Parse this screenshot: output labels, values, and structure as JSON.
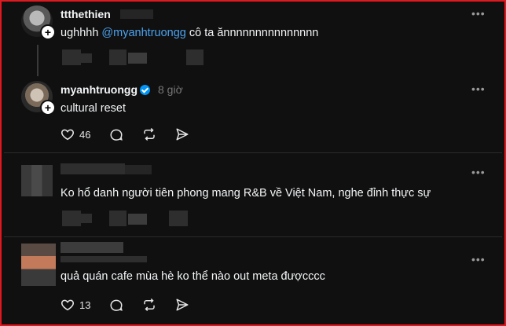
{
  "posts": [
    {
      "username": "ttthethien",
      "text_prefix": "ughhhh ",
      "mention": "@myanhtruongg",
      "text_suffix": " cô ta ănnnnnnnnnnnnnnn",
      "more": "•••"
    },
    {
      "username": "myanhtruongg",
      "time": "8 giờ",
      "text": "cultural reset",
      "likes": "46",
      "more": "•••"
    },
    {
      "text": "Ko hổ danh người tiên phong mang R&B về Việt Nam, nghe đỉnh thực sự",
      "more": "•••"
    },
    {
      "text": "quả quán cafe mùa hè ko thể nào out meta đượcccc",
      "likes": "13",
      "more": "•••"
    }
  ],
  "icons": {
    "like": "heart-icon",
    "comment": "comment-icon",
    "repost": "repost-icon",
    "share": "share-icon",
    "verified": "verified-badge-icon",
    "follow": "plus-icon"
  },
  "colors": {
    "background": "#101010",
    "frame": "#e0181f",
    "mention": "#4aa3f0",
    "verified": "#0095f6"
  }
}
